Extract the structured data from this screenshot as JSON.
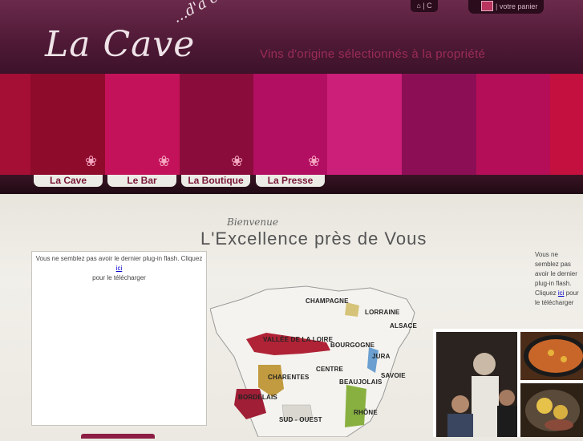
{
  "header": {
    "logo_main": "La Cave",
    "logo_sub": "...d'à côté",
    "tagline": "Vins d'origine sélectionnés à la propriété",
    "home_link": "⌂ | C",
    "cart_label": "| votre panier"
  },
  "colors": {
    "header_bg": "#4e1935",
    "accent": "#9b2c57",
    "stripes": [
      "#a50f35",
      "#8e0b2c",
      "#c4125a",
      "#8a0c3a",
      "#b30f62",
      "#cc1f7a",
      "#8c0f56",
      "#b50e58",
      "#c4103e",
      "#9e0f34"
    ]
  },
  "nav": {
    "tabs": [
      "La Cave",
      "Le Bar",
      "La Boutique",
      "La Presse"
    ]
  },
  "welcome": {
    "small": "Bienvenue",
    "headline": "L'Excellence près de Vous"
  },
  "flash_notice": {
    "text_before": "Vous ne semblez pas avoir le dernier plug-in flash. Cliquez ",
    "link": "ici",
    "text_after": " pour le télécharger"
  },
  "flash_notice_right": {
    "text_before": "Vous ne semblez pas avoir le dernier plug-in flash. Cliquez ",
    "link": "ici",
    "text_after": " pour le télécharger"
  },
  "map": {
    "regions": [
      "CHAMPAGNE",
      "LORRAINE",
      "ALSACE",
      "VALLÉE DE LA LOIRE",
      "BOURGOGNE",
      "JURA",
      "CENTRE",
      "SAVOIE",
      "CHARENTES",
      "BEAUJOLAIS",
      "BORDELAIS",
      "RHÔNE",
      "SUD - OUEST"
    ]
  }
}
